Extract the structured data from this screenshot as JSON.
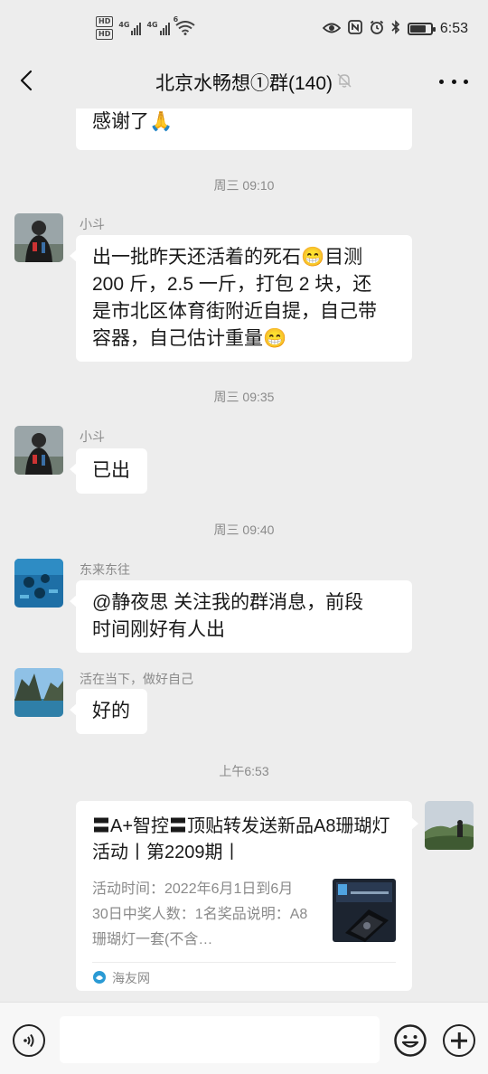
{
  "status_bar": {
    "time": "6:53",
    "hd_top": "HD",
    "hd_bottom": "HD",
    "sim1_label": "4G",
    "sim2_label": "4G",
    "wifi_label": "6",
    "icons": [
      "eye-icon",
      "nfc-icon",
      "alarm-icon",
      "bluetooth-icon",
      "battery-icon"
    ]
  },
  "header": {
    "title": "北京水畅想①群(140)",
    "muted": true
  },
  "messages": [
    {
      "type": "text_partial",
      "text": "感谢了🙏"
    },
    {
      "type": "time",
      "text": "周三 09:10"
    },
    {
      "type": "text",
      "sender": "小斗",
      "lines": [
        "出一批昨天还活着的死石😁目测",
        "200 斤，2.5 一斤，打包 2 块，还",
        "是市北区体育街附近自提，自己带",
        "容器，自己估计重量😁"
      ]
    },
    {
      "type": "time",
      "text": "周三 09:35"
    },
    {
      "type": "text",
      "sender": "小斗",
      "lines": [
        "已出"
      ]
    },
    {
      "type": "time",
      "text": "周三 09:40"
    },
    {
      "type": "text",
      "sender": "东来东往",
      "lines": [
        "@静夜思  关注我的群消息，前段",
        "时间刚好有人出"
      ]
    },
    {
      "type": "text",
      "sender": "活在当下，做好自己",
      "lines": [
        "好的"
      ]
    },
    {
      "type": "time",
      "text": "上午6:53"
    },
    {
      "type": "link_card",
      "sender": "self",
      "title": "〓A+智控〓顶贴转发送新品A8珊瑚灯活动丨第2209期丨",
      "description": "活动时间：2022年6月1日到6月30日中奖人数：1名奖品说明：A8珊瑚灯一套(不含…",
      "source": "海友网"
    }
  ],
  "input": {
    "value": "",
    "placeholder": ""
  },
  "colors": {
    "background": "#ededed",
    "bubble": "#ffffff",
    "timestamp": "#8a8a8a",
    "text": "#191919"
  }
}
